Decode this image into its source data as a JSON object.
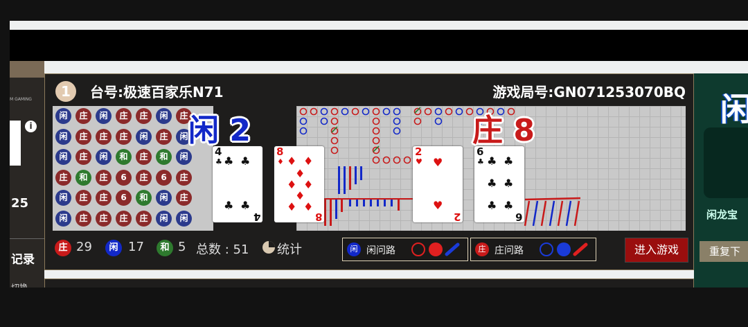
{
  "sidebar": {
    "brand": "M GAMING",
    "info_icon": "i",
    "count": "25",
    "record_label": "记录",
    "sub_label": "切换"
  },
  "table": {
    "number_badge": "1",
    "label": "台号:极速百家乐N71",
    "round": "游戏局号:GN071253070BQ"
  },
  "result": {
    "player_label": "闲",
    "player_score": "2",
    "banker_label": "庄",
    "banker_score": "8",
    "player_cards": [
      {
        "rank": "4",
        "suit": "♣",
        "color": "black"
      },
      {
        "rank": "8",
        "suit": "♦",
        "color": "red"
      }
    ],
    "banker_cards": [
      {
        "rank": "2",
        "suit": "♥",
        "color": "red"
      },
      {
        "rank": "6",
        "suit": "♣",
        "color": "black"
      }
    ]
  },
  "bead_road": [
    [
      "闲",
      "庄",
      "闲",
      "庄",
      "庄",
      "闲",
      "庄"
    ],
    [
      "闲",
      "庄",
      "庄",
      "庄",
      "闲",
      "庄",
      "闲"
    ],
    [
      "闲",
      "庄",
      "闲",
      "和",
      "庄",
      "和",
      "闲"
    ],
    [
      "庄",
      "和",
      "庄",
      "6",
      "庄",
      "6",
      "庄"
    ],
    [
      "闲",
      "庄",
      "庄",
      "6",
      "和",
      "闲",
      "庄"
    ],
    [
      "闲",
      "庄",
      "庄",
      "庄",
      "庄",
      "闲",
      "闲"
    ]
  ],
  "stats": {
    "banker_badge": "庄",
    "banker_count": "29",
    "player_badge": "闲",
    "player_count": "17",
    "tie_badge": "和",
    "tie_count": "5",
    "total_label": "总数 : 51",
    "stats_label": "统计"
  },
  "road_buttons": {
    "player_badge": "闲",
    "player_label": "闲问路",
    "banker_badge": "庄",
    "banker_label": "庄问路"
  },
  "enter_game": "进入游戏",
  "right_panel": {
    "big_char": "闲",
    "dragon_label": "闲龙宝",
    "repeat_label": "重复下"
  },
  "colors": {
    "banker_red": "#c81a1a",
    "player_blue": "#1228c8",
    "tie_green": "#2e7a2e",
    "enter_button": "#9a0e0e"
  }
}
